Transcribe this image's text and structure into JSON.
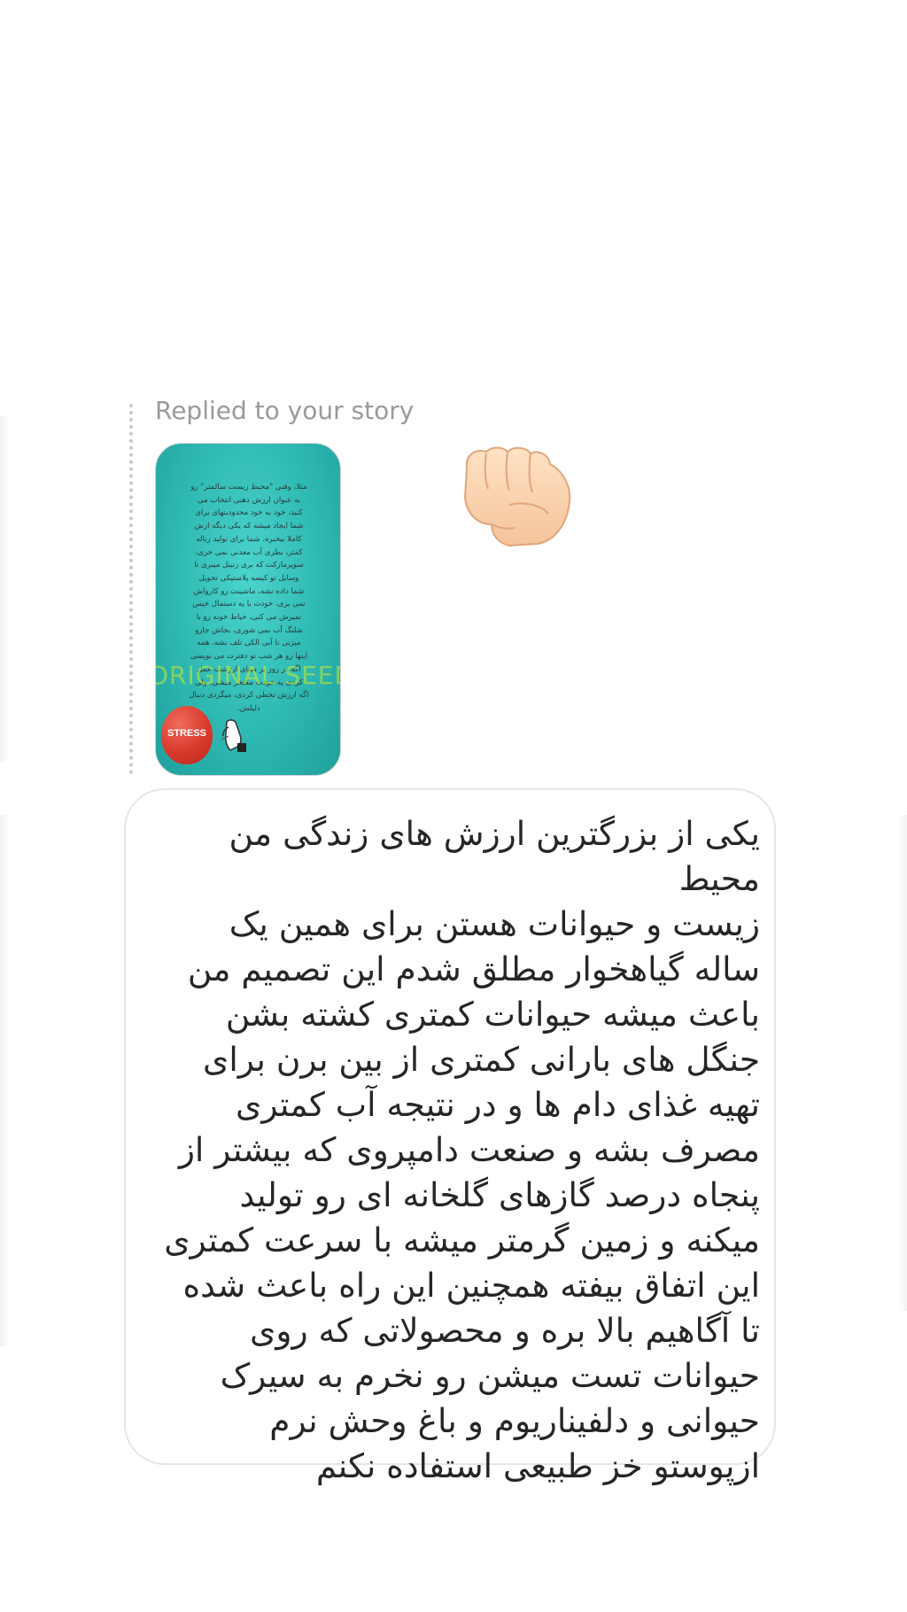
{
  "reply": {
    "label": "Replied to your story"
  },
  "story": {
    "text": "مثلا، وقتی \"محیط زیست سالمتر\" رو\nبه عنوان ارزش ذهنی انتخاب می\nکنید، خود به خود محدودیتهای برای\nشما ایجاد میشه که یکی دیگه ازش\nکاملا بیخبره. شما برای تولید زباله\nکمتر، بطری آب معدنی نمی خری،\nسوپرمارکت که بری زنبیل میبری تا\nوسایل تو کیسه پلاستیکی تحویل\nشما داده نشه، ماشینت رو کارواش\nنمی بری، خودت با یه دستمال خیس\nتمیزش می کنی، حیاط خونه رو با\nشلنگ آب نمی شوری، بجاش جارو\nمیزنی تا آبی الکی تلف نشه. همه\nاینها رو هر شب تو دفترت می نویسی\nاگه در روز بر مبنای ارزشت عمل\nکردی یه خودت مقتخر میشی. ولی\nاگه ارزش تخطی کردی، میگردی دنبال\nدلیلش.",
    "watermark": "ORIGINAL SEED",
    "sticker_label": "STRESS"
  },
  "reaction": {
    "emoji": "fist-emoji"
  },
  "message": {
    "text": "یکی از بزرگترین ارزش های زندگی من محیط\nزیست و حیوانات هستن برای همین یک\nساله گیاهخوار مطلق شدم این تصمیم من\nباعث میشه حیوانات کمتری کشته بشن\nجنگل های بارانی کمتری از بین برن برای\nتهیه غذای دام ها و در نتیجه آب کمتری\nمصرف بشه و صنعت دامپروی که بیشتر از\nپنجاه درصد گازهای گلخانه ای رو تولید\nمیکنه و زمین گرمتر میشه با سرعت کمتری\nاین اتفاق بیفته همچنین این راه باعث شده\nتا آگاهیم بالا بره و محصولاتی که روی\nحیوانات تست میشن رو نخرم به سیرک\nحیوانی و دلفیناریوم و باغ وحش نرم\nازپوستو خز طبیعی استفاده نکنم"
  },
  "colors": {
    "background": "#ffffff",
    "label_gray": "#9a9a9a",
    "bubble_border": "#e6e6e6",
    "message_text": "#262626",
    "story_teal": "#2fb9b3",
    "balloon_red": "#d83a2c"
  }
}
